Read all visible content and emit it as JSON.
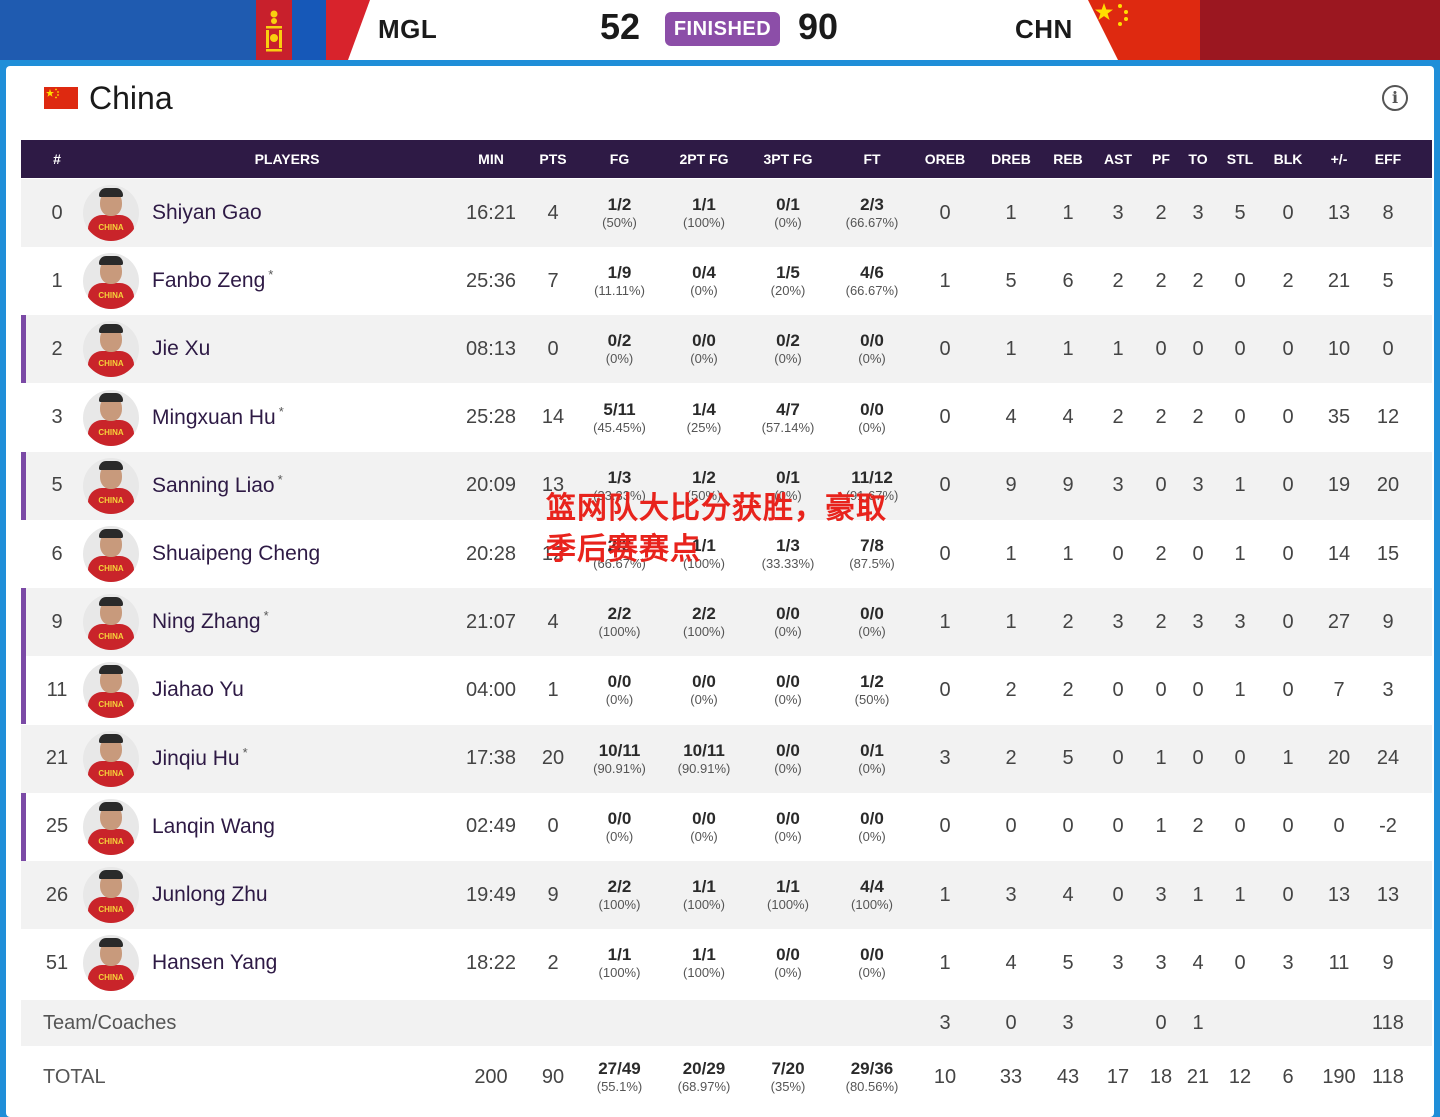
{
  "scoreboard": {
    "team_a_code": "MGL",
    "team_a_score": "52",
    "status": "FINISHED",
    "team_b_score": "90",
    "team_b_code": "CHN"
  },
  "team": {
    "name": "China"
  },
  "columns": [
    "#",
    "PLAYERS",
    "MIN",
    "PTS",
    "FG",
    "2PT FG",
    "3PT FG",
    "FT",
    "OREB",
    "DREB",
    "REB",
    "AST",
    "PF",
    "TO",
    "STL",
    "BLK",
    "+/-",
    "EFF"
  ],
  "players": [
    {
      "num": "0",
      "name": "Shiyan Gao",
      "star": false,
      "min": "16:21",
      "pts": "4",
      "fg": "1/2",
      "fg_pct": "(50%)",
      "two": "1/1",
      "two_pct": "(100%)",
      "three": "0/1",
      "three_pct": "(0%)",
      "ft": "2/3",
      "ft_pct": "(66.67%)",
      "oreb": "0",
      "dreb": "1",
      "reb": "1",
      "ast": "3",
      "pf": "2",
      "to": "3",
      "stl": "5",
      "blk": "0",
      "pm": "13",
      "eff": "8"
    },
    {
      "num": "1",
      "name": "Fanbo Zeng",
      "star": true,
      "min": "25:36",
      "pts": "7",
      "fg": "1/9",
      "fg_pct": "(11.11%)",
      "two": "0/4",
      "two_pct": "(0%)",
      "three": "1/5",
      "three_pct": "(20%)",
      "ft": "4/6",
      "ft_pct": "(66.67%)",
      "oreb": "1",
      "dreb": "5",
      "reb": "6",
      "ast": "2",
      "pf": "2",
      "to": "2",
      "stl": "0",
      "blk": "2",
      "pm": "21",
      "eff": "5"
    },
    {
      "num": "2",
      "name": "Jie Xu",
      "star": false,
      "min": "08:13",
      "pts": "0",
      "fg": "0/2",
      "fg_pct": "(0%)",
      "two": "0/0",
      "two_pct": "(0%)",
      "three": "0/2",
      "three_pct": "(0%)",
      "ft": "0/0",
      "ft_pct": "(0%)",
      "oreb": "0",
      "dreb": "1",
      "reb": "1",
      "ast": "1",
      "pf": "0",
      "to": "0",
      "stl": "0",
      "blk": "0",
      "pm": "10",
      "eff": "0"
    },
    {
      "num": "3",
      "name": "Mingxuan Hu",
      "star": true,
      "min": "25:28",
      "pts": "14",
      "fg": "5/11",
      "fg_pct": "(45.45%)",
      "two": "1/4",
      "two_pct": "(25%)",
      "three": "4/7",
      "three_pct": "(57.14%)",
      "ft": "0/0",
      "ft_pct": "(0%)",
      "oreb": "0",
      "dreb": "4",
      "reb": "4",
      "ast": "2",
      "pf": "2",
      "to": "2",
      "stl": "0",
      "blk": "0",
      "pm": "35",
      "eff": "12"
    },
    {
      "num": "5",
      "name": "Sanning Liao",
      "star": true,
      "min": "20:09",
      "pts": "13",
      "fg": "1/3",
      "fg_pct": "(33.33%)",
      "two": "1/2",
      "two_pct": "(50%)",
      "three": "0/1",
      "three_pct": "(0%)",
      "ft": "11/12",
      "ft_pct": "(91.67%)",
      "oreb": "0",
      "dreb": "9",
      "reb": "9",
      "ast": "3",
      "pf": "0",
      "to": "3",
      "stl": "1",
      "blk": "0",
      "pm": "19",
      "eff": "20"
    },
    {
      "num": "6",
      "name": "Shuaipeng Cheng",
      "star": false,
      "min": "20:28",
      "pts": "12",
      "fg": "2/3",
      "fg_pct": "(66.67%)",
      "two": "1/1",
      "two_pct": "(100%)",
      "three": "1/3",
      "three_pct": "(33.33%)",
      "ft": "7/8",
      "ft_pct": "(87.5%)",
      "oreb": "0",
      "dreb": "1",
      "reb": "1",
      "ast": "0",
      "pf": "2",
      "to": "0",
      "stl": "1",
      "blk": "0",
      "pm": "14",
      "eff": "15"
    },
    {
      "num": "9",
      "name": "Ning Zhang",
      "star": true,
      "min": "21:07",
      "pts": "4",
      "fg": "2/2",
      "fg_pct": "(100%)",
      "two": "2/2",
      "two_pct": "(100%)",
      "three": "0/0",
      "three_pct": "(0%)",
      "ft": "0/0",
      "ft_pct": "(0%)",
      "oreb": "1",
      "dreb": "1",
      "reb": "2",
      "ast": "3",
      "pf": "2",
      "to": "3",
      "stl": "3",
      "blk": "0",
      "pm": "27",
      "eff": "9"
    },
    {
      "num": "11",
      "name": "Jiahao Yu",
      "star": false,
      "min": "04:00",
      "pts": "1",
      "fg": "0/0",
      "fg_pct": "(0%)",
      "two": "0/0",
      "two_pct": "(0%)",
      "three": "0/0",
      "three_pct": "(0%)",
      "ft": "1/2",
      "ft_pct": "(50%)",
      "oreb": "0",
      "dreb": "2",
      "reb": "2",
      "ast": "0",
      "pf": "0",
      "to": "0",
      "stl": "1",
      "blk": "0",
      "pm": "7",
      "eff": "3"
    },
    {
      "num": "21",
      "name": "Jinqiu Hu",
      "star": true,
      "min": "17:38",
      "pts": "20",
      "fg": "10/11",
      "fg_pct": "(90.91%)",
      "two": "10/11",
      "two_pct": "(90.91%)",
      "three": "0/0",
      "three_pct": "(0%)",
      "ft": "0/1",
      "ft_pct": "(0%)",
      "oreb": "3",
      "dreb": "2",
      "reb": "5",
      "ast": "0",
      "pf": "1",
      "to": "0",
      "stl": "0",
      "blk": "1",
      "pm": "20",
      "eff": "24"
    },
    {
      "num": "25",
      "name": "Lanqin Wang",
      "star": false,
      "min": "02:49",
      "pts": "0",
      "fg": "0/0",
      "fg_pct": "(0%)",
      "two": "0/0",
      "two_pct": "(0%)",
      "three": "0/0",
      "three_pct": "(0%)",
      "ft": "0/0",
      "ft_pct": "(0%)",
      "oreb": "0",
      "dreb": "0",
      "reb": "0",
      "ast": "0",
      "pf": "1",
      "to": "2",
      "stl": "0",
      "blk": "0",
      "pm": "0",
      "eff": "-2"
    },
    {
      "num": "26",
      "name": "Junlong Zhu",
      "star": false,
      "min": "19:49",
      "pts": "9",
      "fg": "2/2",
      "fg_pct": "(100%)",
      "two": "1/1",
      "two_pct": "(100%)",
      "three": "1/1",
      "three_pct": "(100%)",
      "ft": "4/4",
      "ft_pct": "(100%)",
      "oreb": "1",
      "dreb": "3",
      "reb": "4",
      "ast": "0",
      "pf": "3",
      "to": "1",
      "stl": "1",
      "blk": "0",
      "pm": "13",
      "eff": "13"
    },
    {
      "num": "51",
      "name": "Hansen Yang",
      "star": false,
      "min": "18:22",
      "pts": "2",
      "fg": "1/1",
      "fg_pct": "(100%)",
      "two": "1/1",
      "two_pct": "(100%)",
      "three": "0/0",
      "three_pct": "(0%)",
      "ft": "0/0",
      "ft_pct": "(0%)",
      "oreb": "1",
      "dreb": "4",
      "reb": "5",
      "ast": "3",
      "pf": "3",
      "to": "4",
      "stl": "0",
      "blk": "3",
      "pm": "11",
      "eff": "9"
    }
  ],
  "team_coaches": {
    "label": "Team/Coaches",
    "oreb": "3",
    "dreb": "0",
    "reb": "3",
    "pf": "0",
    "to": "1",
    "eff": "118"
  },
  "total": {
    "label": "TOTAL",
    "min": "200",
    "pts": "90",
    "fg": "27/49",
    "fg_pct": "(55.1%)",
    "two": "20/29",
    "two_pct": "(68.97%)",
    "three": "7/20",
    "three_pct": "(35%)",
    "ft": "29/36",
    "ft_pct": "(80.56%)",
    "oreb": "10",
    "dreb": "33",
    "reb": "43",
    "ast": "17",
    "pf": "18",
    "to": "21",
    "stl": "12",
    "blk": "6",
    "pm": "190",
    "eff": "118"
  },
  "overlay_text": "篮网队大比分获胜，豪取季后赛赛点",
  "avatar_jersey_text": "CHINA",
  "colors": {
    "header_bg": "#2e1a45",
    "accent_purple": "#7b4aa6",
    "badge": "#8c4ea8",
    "frame_blue": "#1f8ed8",
    "overlay_red": "#e8231c"
  },
  "icons": [
    "mongolia-flag-icon",
    "china-flag-icon",
    "info-icon",
    "player-avatar-icon"
  ]
}
